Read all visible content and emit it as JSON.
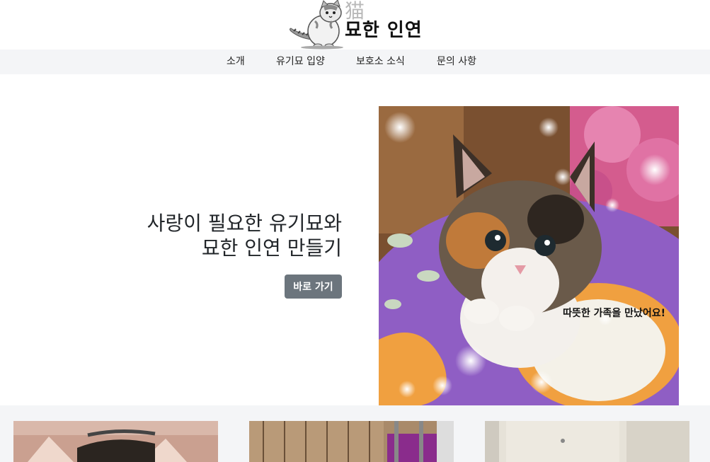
{
  "header": {
    "logo_hanja": "猫",
    "logo_text": "묘한 인연"
  },
  "nav": {
    "items": [
      {
        "label": "소개"
      },
      {
        "label": "유기묘 입양"
      },
      {
        "label": "보호소 소식"
      },
      {
        "label": "문의 사항"
      }
    ]
  },
  "hero": {
    "title_line1": "사랑이 필요한 유기묘와",
    "title_line2": "묘한 인연 만들기",
    "button_label": "바로 가기",
    "image_caption": "따뜻한 가족을 만났어요!"
  },
  "colors": {
    "nav_bg": "#f4f5f7",
    "button_bg": "#6c757d",
    "text": "#212529"
  }
}
